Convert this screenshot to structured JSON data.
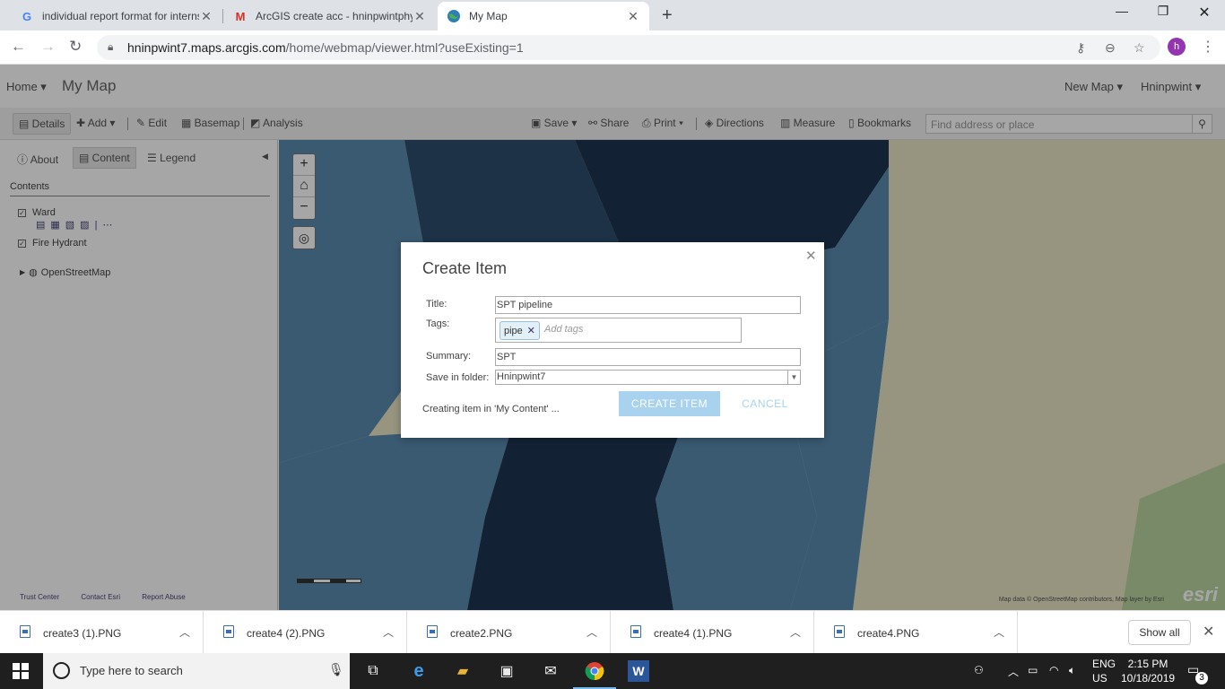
{
  "browser": {
    "tabs": [
      {
        "title": "individual report format for internsh",
        "icon": "google-icon",
        "active": false
      },
      {
        "title": "ArcGIS create acc - hninpwintphyua",
        "icon": "gmail-icon",
        "active": false
      },
      {
        "title": "My Map",
        "icon": "arcgis-globe-icon",
        "active": true
      }
    ],
    "url_host": "hninpwint7.maps.arcgis.com",
    "url_path": "/home/webmap/viewer.html?useExisting=1",
    "profile_initial": "h"
  },
  "arcgis": {
    "home": "Home ▾",
    "map_name": "My Map",
    "new_map": "New Map ▾",
    "user": "Hninpwint ▾",
    "toolbar": {
      "details": "Details",
      "add": "Add ▾",
      "edit": "Edit",
      "basemap": "Basemap",
      "analysis": "Analysis",
      "save": "Save ▾",
      "share": "Share",
      "print": "Print ▾",
      "directions": "Directions",
      "measure": "Measure",
      "bookmarks": "Bookmarks",
      "search_placeholder": "Find address or place"
    },
    "sidepanel": {
      "tabs": [
        "About",
        "Content",
        "Legend"
      ],
      "contents_header": "Contents",
      "layers": [
        "Ward",
        "Fire Hydrant",
        "OpenStreetMap"
      ],
      "footer_links": [
        "Trust Center",
        "Contact Esri",
        "Report Abuse"
      ]
    },
    "map": {
      "attribution": "Map data © OpenStreetMap contributors, Map layer by Esri",
      "esri_logo": "esri",
      "colors": {
        "dark_ward": "#1c3550",
        "mid_ward": "#2d4e6e",
        "light_ward": "#5a8bb0",
        "base": "#e8e4c4",
        "park": "#b8d4a0"
      }
    }
  },
  "dialog": {
    "title": "Create Item",
    "title_label": "Title:",
    "title_value": "SPT pipeline",
    "tags_label": "Tags:",
    "tag_chip": "pipe",
    "tags_placeholder": "Add tags",
    "summary_label": "Summary:",
    "summary_value": "SPT",
    "folder_label": "Save in folder:",
    "folder_value": "Hninpwint7",
    "status": "Creating item in 'My Content' ...",
    "create_button": "CREATE ITEM",
    "cancel_button": "CANCEL"
  },
  "downloads": {
    "files": [
      "create3 (1).PNG",
      "create4 (2).PNG",
      "create2.PNG",
      "create4 (1).PNG",
      "create4.PNG"
    ],
    "show_all": "Show all"
  },
  "taskbar": {
    "search_placeholder": "Type here to search",
    "lang_line1": "ENG",
    "lang_line2": "US",
    "time": "2:15 PM",
    "date": "10/18/2019",
    "notifications": "3"
  }
}
